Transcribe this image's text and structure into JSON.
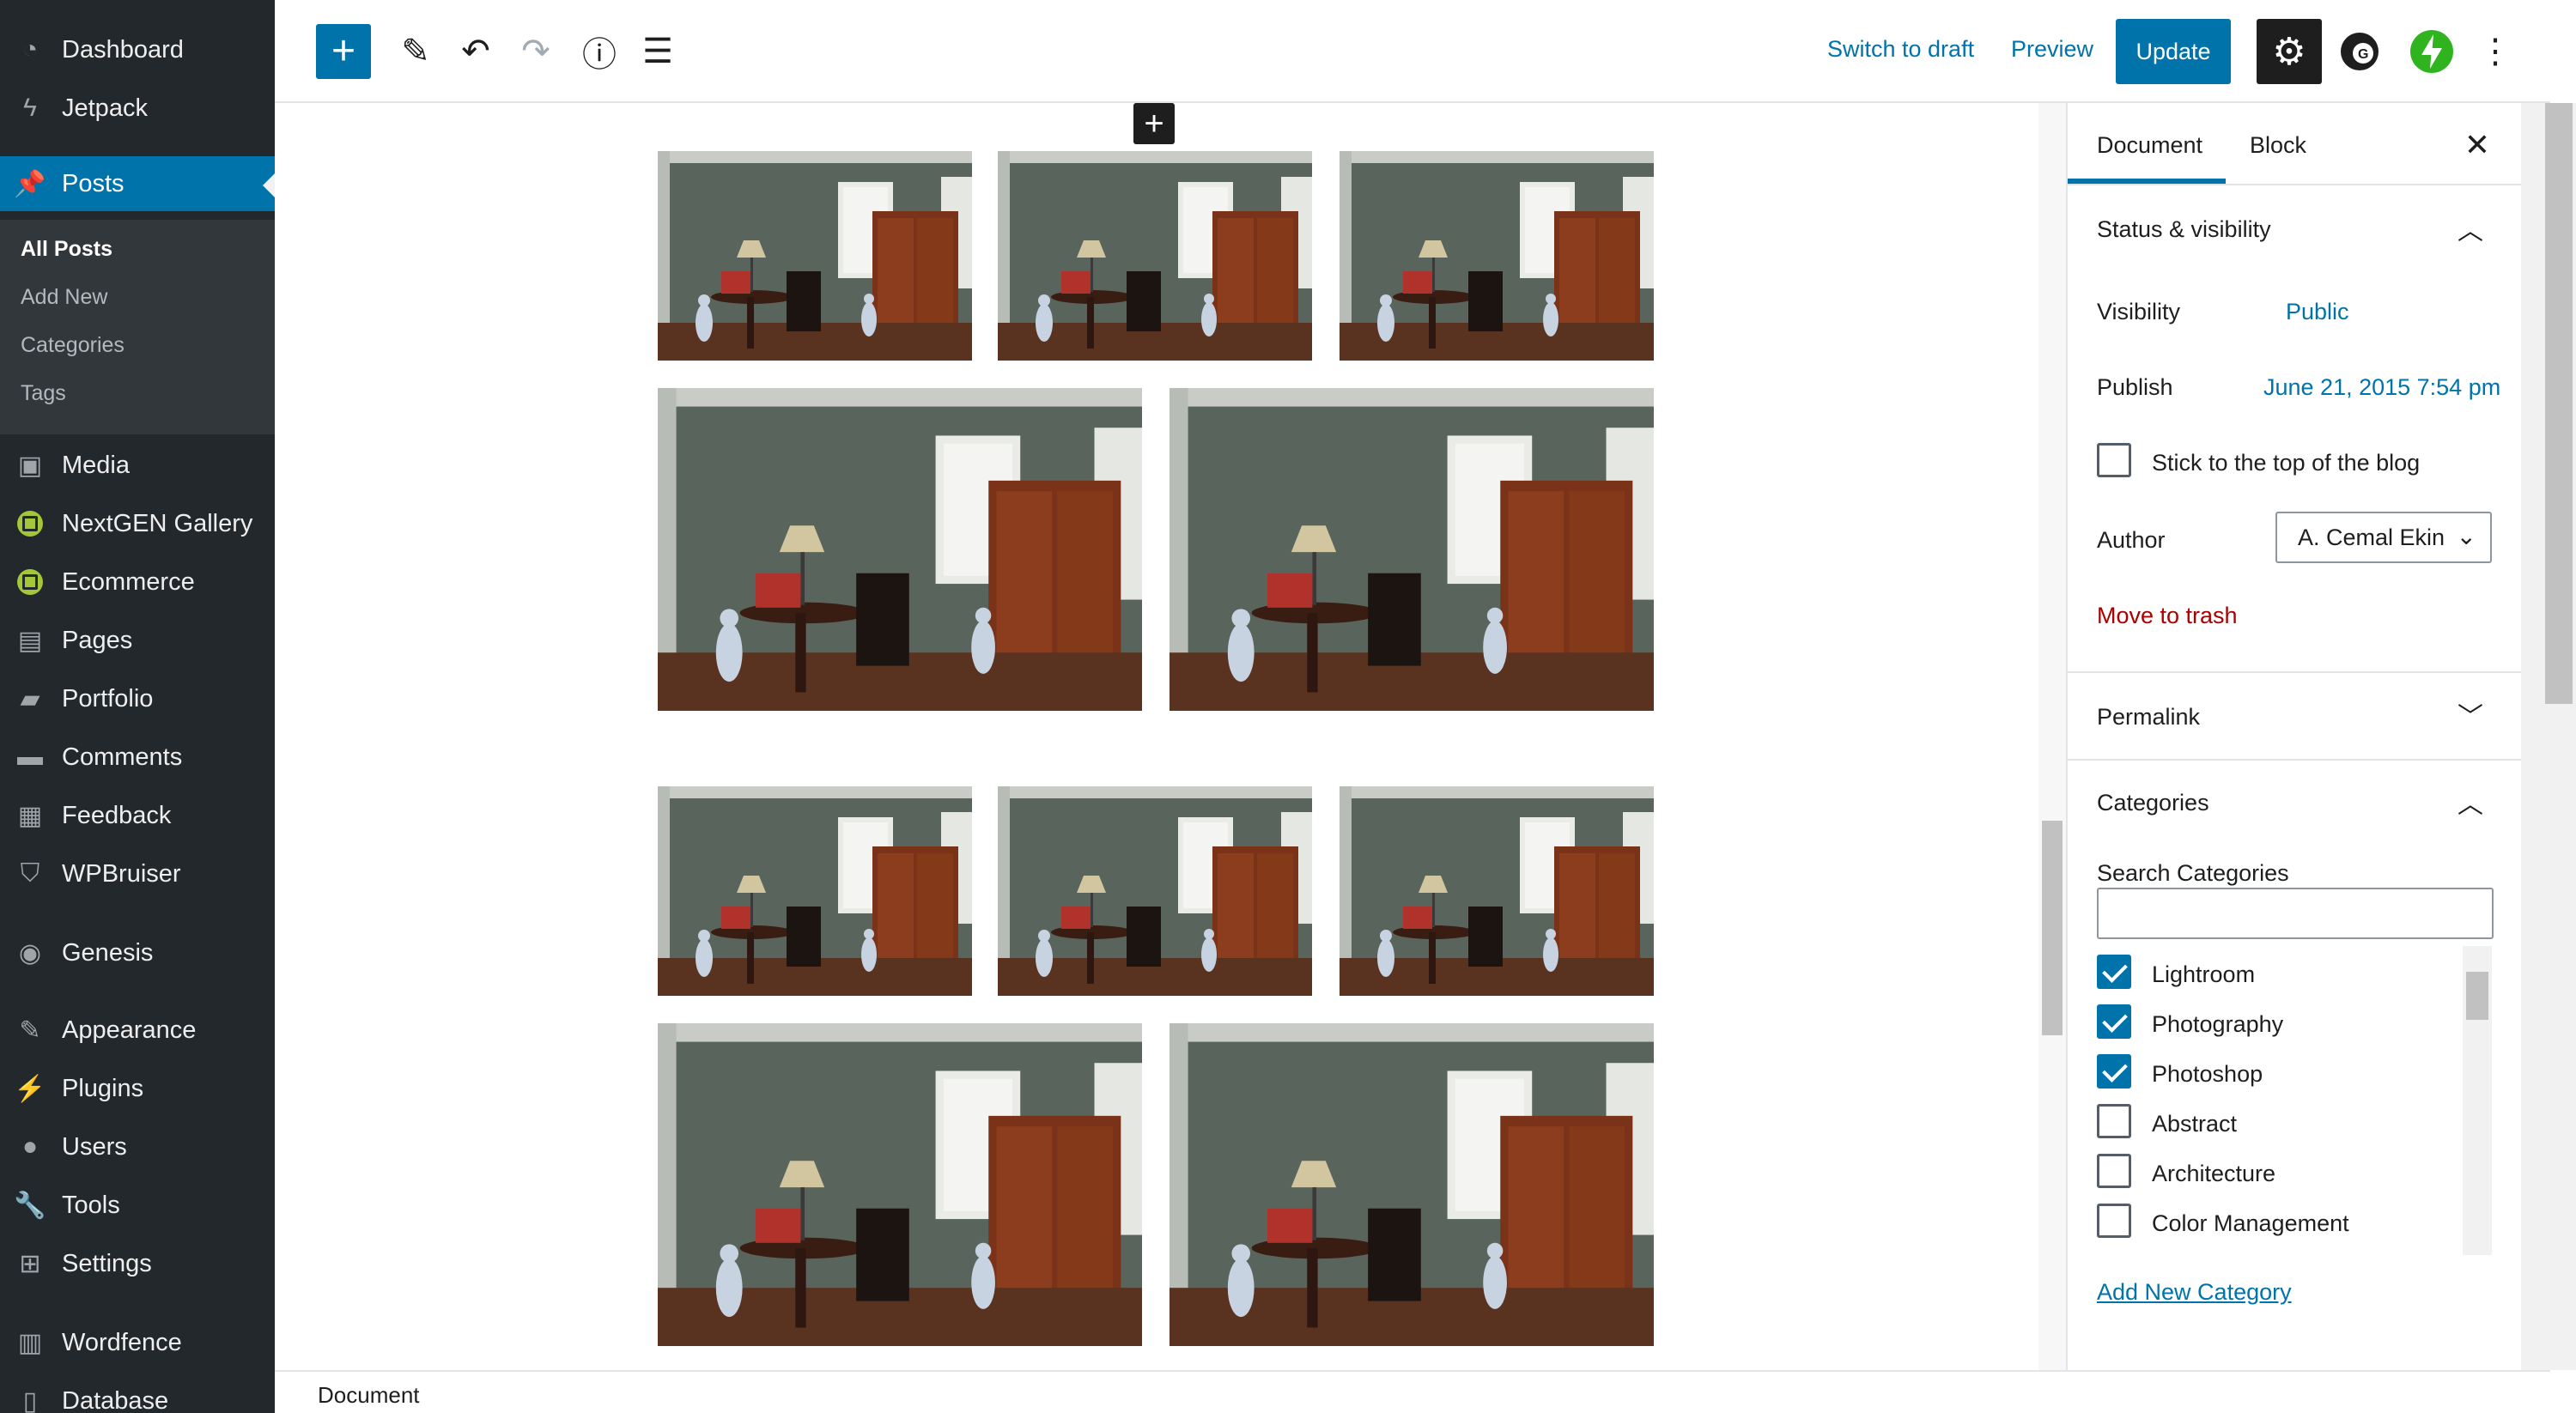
{
  "sidebar": {
    "items": [
      {
        "label": "Dashboard",
        "icon": "dashboard-icon"
      },
      {
        "label": "Jetpack",
        "icon": "jetpack-icon"
      },
      {
        "label": "Posts",
        "icon": "pin-icon"
      },
      {
        "label": "Media",
        "icon": "media-icon"
      },
      {
        "label": "NextGEN Gallery",
        "icon": "nextgen-icon"
      },
      {
        "label": "Ecommerce",
        "icon": "ecommerce-icon"
      },
      {
        "label": "Pages",
        "icon": "pages-icon"
      },
      {
        "label": "Portfolio",
        "icon": "folder-icon"
      },
      {
        "label": "Comments",
        "icon": "comment-icon"
      },
      {
        "label": "Feedback",
        "icon": "feedback-icon"
      },
      {
        "label": "WPBruiser",
        "icon": "shield-icon"
      },
      {
        "label": "Genesis",
        "icon": "genesis-icon"
      },
      {
        "label": "Appearance",
        "icon": "brush-icon"
      },
      {
        "label": "Plugins",
        "icon": "plugin-icon"
      },
      {
        "label": "Users",
        "icon": "user-icon"
      },
      {
        "label": "Tools",
        "icon": "wrench-icon"
      },
      {
        "label": "Settings",
        "icon": "settings-icon"
      },
      {
        "label": "Wordfence",
        "icon": "wordfence-icon"
      },
      {
        "label": "Database",
        "icon": "database-icon"
      }
    ],
    "posts_submenu": [
      "All Posts",
      "Add New",
      "Categories",
      "Tags"
    ]
  },
  "toolbar": {
    "add_block": "+",
    "switch_to_draft": "Switch to draft",
    "preview": "Preview",
    "update": "Update"
  },
  "canvas": {
    "insert_label": "+"
  },
  "panel": {
    "tabs": [
      "Document",
      "Block"
    ],
    "status_visibility": "Status & visibility",
    "visibility_label": "Visibility",
    "visibility_value": "Public",
    "publish_label": "Publish",
    "publish_value": "June 21, 2015 7:54 pm",
    "sticky_label": "Stick to the top of the blog",
    "author_label": "Author",
    "author_value": "A. Cemal Ekin",
    "move_to_trash": "Move to trash",
    "permalink": "Permalink",
    "categories": "Categories",
    "search_categories": "Search Categories",
    "category_list": [
      {
        "name": "Lightroom",
        "checked": true
      },
      {
        "name": "Photography",
        "checked": true
      },
      {
        "name": "Photoshop",
        "checked": true
      },
      {
        "name": "Abstract",
        "checked": false
      },
      {
        "name": "Architecture",
        "checked": false
      },
      {
        "name": "Color Management",
        "checked": false
      }
    ],
    "add_new_category": "Add New Category"
  },
  "footer": {
    "breadcrumb": "Document"
  },
  "colors": {
    "sidebar_bg": "#23282d",
    "accent": "#0073aa",
    "danger": "#a00"
  }
}
